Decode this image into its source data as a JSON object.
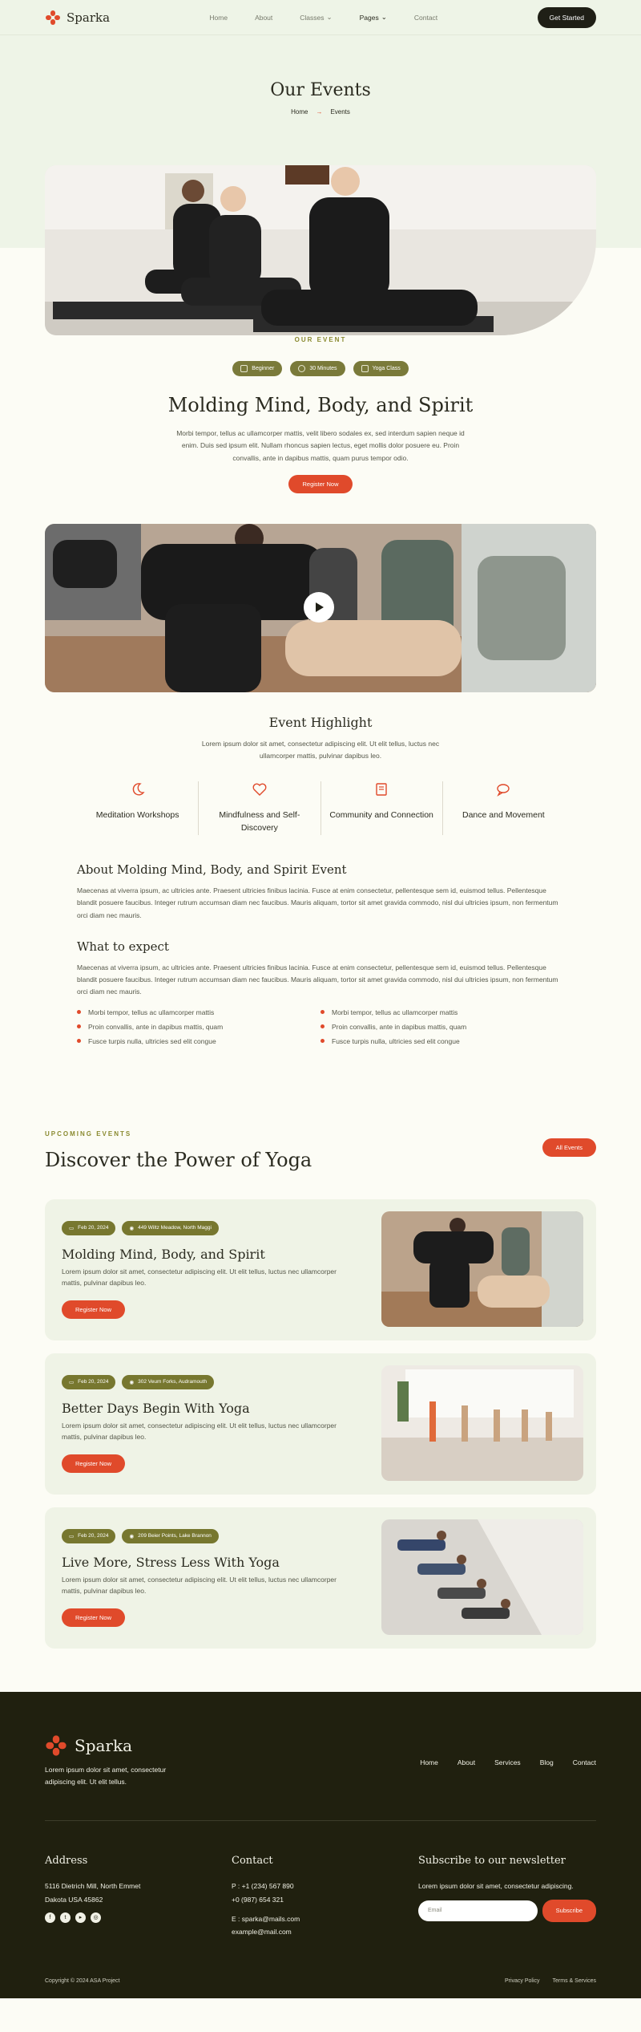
{
  "header": {
    "brand": "Sparka",
    "nav": [
      "Home",
      "About",
      "Classes",
      "Pages",
      "Contact"
    ],
    "cta": "Get Started"
  },
  "hero": {
    "title": "Our Events",
    "breadcrumb": [
      "Home",
      "Events"
    ]
  },
  "event": {
    "eyebrow": "OUR EVENT",
    "tags": [
      "Beginner",
      "30 Minutes",
      "Yoga Class"
    ],
    "title": "Molding Mind, Body, and Spirit",
    "description": "Morbi tempor, tellus ac ullamcorper mattis, velit libero sodales ex, sed interdum sapien neque id enim. Duis sed ipsum elit. Nullam rhoncus sapien lectus, eget mollis dolor posuere eu. Proin convallis, ante in dapibus mattis, quam purus tempor odio.",
    "register": "Register Now"
  },
  "highlight": {
    "title": "Event Highlight",
    "text": "Lorem ipsum dolor sit amet, consectetur adipiscing elit. Ut elit tellus, luctus nec ullamcorper mattis, pulvinar dapibus leo.",
    "features": [
      {
        "icon": "moon-icon",
        "label": "Meditation Workshops"
      },
      {
        "icon": "heart-icon",
        "label": "Mindfulness and Self-Discovery"
      },
      {
        "icon": "book-icon",
        "label": "Community and Connection"
      },
      {
        "icon": "chat-icon",
        "label": "Dance and Movement"
      }
    ]
  },
  "about": {
    "title": "About Molding Mind, Body, and Spirit Event",
    "text": "Maecenas at viverra ipsum, ac ultricies ante. Praesent ultricies finibus lacinia. Fusce at enim consectetur, pellentesque sem id, euismod tellus. Pellentesque blandit posuere faucibus. Integer rutrum accumsan diam nec faucibus. Mauris aliquam, tortor sit amet gravida commodo, nisl dui ultricies ipsum, non fermentum orci diam nec mauris.",
    "expect_title": "What to expect",
    "expect_text": "Maecenas at viverra ipsum, ac ultricies ante. Praesent ultricies finibus lacinia. Fusce at enim consectetur, pellentesque sem id, euismod tellus. Pellentesque blandit posuere faucibus. Integer rutrum accumsan diam nec faucibus. Mauris aliquam, tortor sit amet gravida commodo, nisl dui ultricies ipsum, non fermentum orci diam nec mauris.",
    "bullets": [
      "Morbi tempor, tellus ac ullamcorper mattis",
      "Morbi tempor, tellus ac ullamcorper mattis",
      "Proin convallis, ante in dapibus mattis, quam",
      "Proin convallis, ante in dapibus mattis, quam",
      "Fusce turpis nulla, ultricies sed elit congue",
      "Fusce turpis nulla, ultricies sed elit congue"
    ]
  },
  "upcoming": {
    "eyebrow": "UPCOMING EVENTS",
    "title": "Discover the Power of Yoga",
    "all_button": "All Events",
    "events": [
      {
        "date": "Feb 20, 2024",
        "location": "449 Wiltz Meadow, North Maggi",
        "title": "Molding Mind, Body, and Spirit",
        "text": "Lorem ipsum dolor sit amet, consectetur adipiscing elit. Ut elit tellus, luctus nec ullamcorper mattis, pulvinar dapibus leo.",
        "button": "Register Now"
      },
      {
        "date": "Feb 20, 2024",
        "location": "302 Veum Forks, Audramouth",
        "title": "Better Days Begin With Yoga",
        "text": "Lorem ipsum dolor sit amet, consectetur adipiscing elit. Ut elit tellus, luctus nec ullamcorper mattis, pulvinar dapibus leo.",
        "button": "Register Now"
      },
      {
        "date": "Feb 20, 2024",
        "location": "209 Beier Points, Lake Brannon",
        "title": "Live More, Stress Less With Yoga",
        "text": "Lorem ipsum dolor sit amet, consectetur adipiscing elit. Ut elit tellus, luctus nec ullamcorper mattis, pulvinar dapibus leo.",
        "button": "Register Now"
      }
    ]
  },
  "footer": {
    "brand": "Sparka",
    "tagline": "Lorem ipsum dolor sit amet, consectetur adipiscing elit. Ut elit tellus.",
    "nav": [
      "Home",
      "About",
      "Services",
      "Blog",
      "Contact"
    ],
    "address_title": "Address",
    "address": [
      "5116 Dietrich Mill, North Emmet",
      "Dakota USA 45862"
    ],
    "contact_title": "Contact",
    "phones": [
      "P : +1 (234) 567 890",
      "+0 (987) 654 321"
    ],
    "emails": [
      "E : sparka@mails.com",
      "example@mail.com"
    ],
    "newsletter_title": "Subscribe to our newsletter",
    "newsletter_text": "Lorem ipsum dolor sit amet, consectetur adipiscing.",
    "email_placeholder": "Email",
    "subscribe": "Subscribe",
    "copyright": "Copyright © 2024 ASA Project",
    "links": [
      "Privacy Policy",
      "Terms & Services"
    ]
  },
  "colors": {
    "accent": "#e04a2b",
    "olive": "#7a7a3a",
    "dark": "#20200f",
    "mint": "#eef4e7"
  }
}
